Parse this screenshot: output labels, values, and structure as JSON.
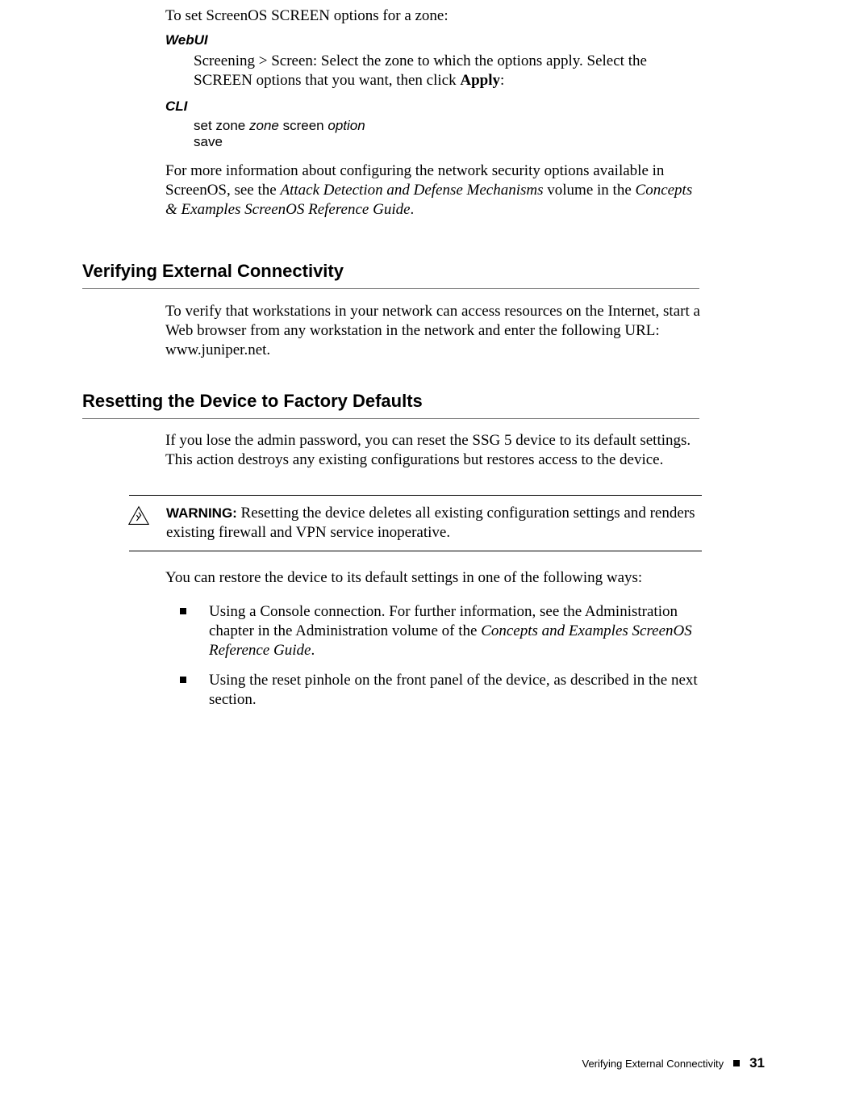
{
  "intro_line": "To set ScreenOS SCREEN options for a zone:",
  "webui_label": "WebUI",
  "webui_text_pre": "Screening > Screen: Select the zone to which the options apply. Select the SCREEN options that you want, then click ",
  "webui_apply": "Apply",
  "webui_text_post": ":",
  "cli_label": "CLI",
  "cli_set_zone": "set zone ",
  "cli_zone_param": "zone",
  "cli_screen": " screen ",
  "cli_option_param": "option",
  "cli_save": "save",
  "more_info_pre": "For more information about configuring the network security options available in ScreenOS, see the ",
  "more_info_ital1": "Attack Detection and Defense Mechanisms",
  "more_info_mid": " volume in the ",
  "more_info_ital2": "Concepts & Examples ScreenOS Reference Guide",
  "more_info_post": ".",
  "h_verify": "Verifying External Connectivity",
  "verify_para": "To verify that workstations in your network can access resources on the Internet, start a Web browser from any workstation in the network and enter the following URL: www.juniper.net.",
  "h_reset": "Resetting the Device to Factory Defaults",
  "reset_para": "If you lose the admin password, you can reset the SSG 5 device to its default settings. This action destroys any existing configurations but restores access to the device.",
  "warn_label": "WARNING: ",
  "warn_text": "Resetting the device deletes all existing configuration settings and renders existing firewall and VPN service inoperative.",
  "restore_line": "You can restore the device to its default settings in one of the following ways:",
  "bullet1_pre": "Using a Console connection. For further information, see the Administration chapter in the Administration volume of the ",
  "bullet1_ital": "Concepts and Examples ScreenOS Reference Guide",
  "bullet1_post": ".",
  "bullet2": "Using the reset pinhole on the front panel of the device, as described in the next section.",
  "footer_title": "Verifying External Connectivity",
  "footer_page": "31"
}
